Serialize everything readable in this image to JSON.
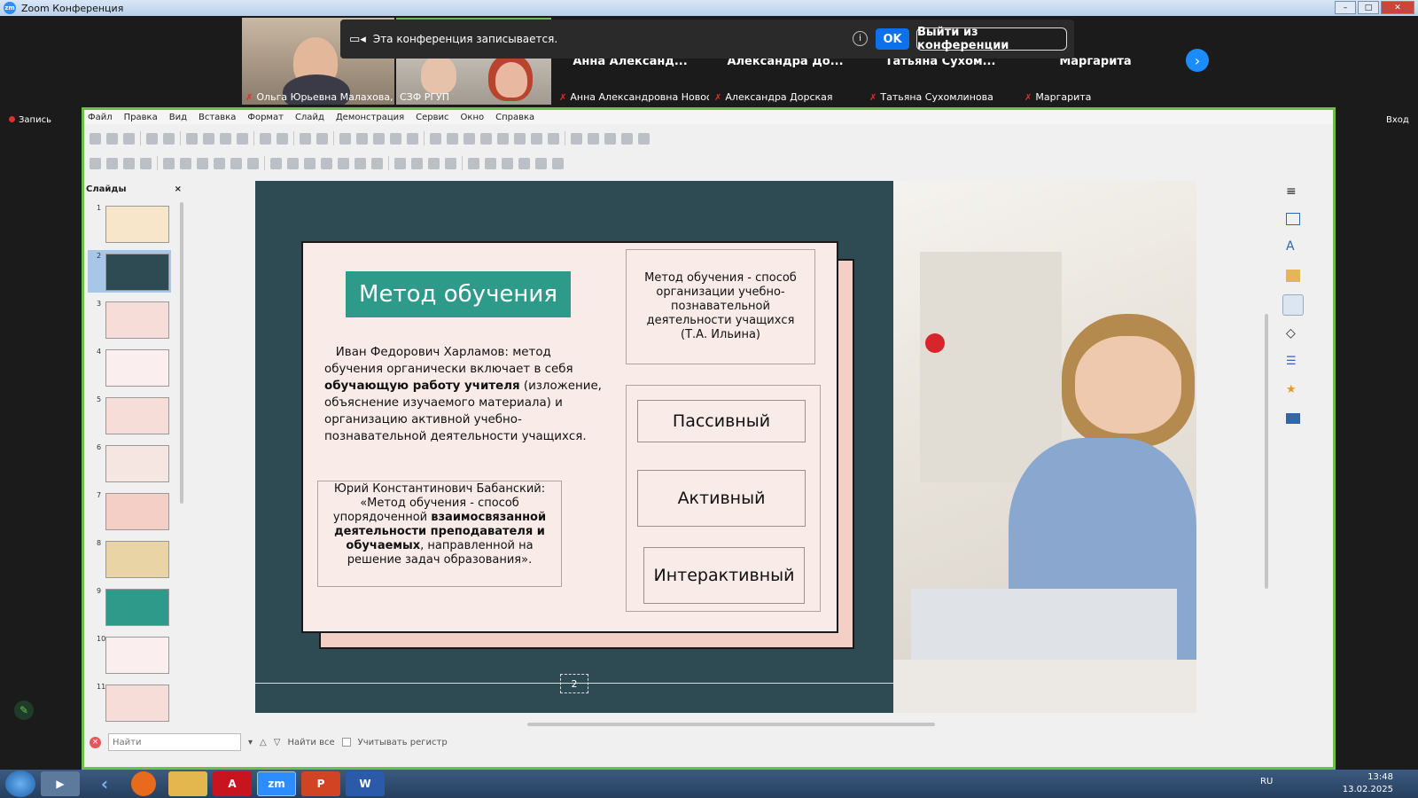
{
  "window": {
    "title": "Zoom Конференция",
    "icon": "zm"
  },
  "recording_notice": {
    "text": "Эта конференция записывается.",
    "ok": "OK",
    "leave": "Выйти из конференции"
  },
  "participants": [
    {
      "name": "Ольга Юрьевна Малахова, ..."
    },
    {
      "name": "СЗФ РГУП"
    },
    {
      "big": "Анна  Александ...",
      "name": "Анна Александровна Новосе..."
    },
    {
      "big": "Александра  До...",
      "name": "Александра Дорская"
    },
    {
      "big": "Татьяна  Сухом...",
      "name": "Татьяна Сухомлинова"
    },
    {
      "big": "Маргарита",
      "name": "Маргарита"
    }
  ],
  "left_label": "Запись",
  "right_label": "Вход",
  "menu": [
    "Файл",
    "Правка",
    "Вид",
    "Вставка",
    "Формат",
    "Слайд",
    "Демонстрация",
    "Сервис",
    "Окно",
    "Справка"
  ],
  "slides_panel": {
    "title": "Слайды",
    "close": "×",
    "numbers": [
      "1",
      "2",
      "3",
      "4",
      "5",
      "6",
      "7",
      "8",
      "9",
      "10",
      "11"
    ]
  },
  "slide": {
    "title": "Метод обучения",
    "kharlamov_name": "Иван Федорович Харламов",
    "kharlamov_pre": ": метод обучения органически включает в себя ",
    "kharlamov_bold": "обучающую работу учителя",
    "kharlamov_post": " (изложение, объяснение изучаемого материала) и организацию активной учебно-познавательной деятельности учащихся.",
    "babansky_line1": "Юрий Константинович Бабанский:",
    "babansky_pre": "«Метод обучения  - способ упорядоченной ",
    "babansky_bold": "взаимосвязанной деятельности преподавателя и обучаемых",
    "babansky_post": ", направленной на решение задач образования».",
    "definition": "Метод обучения - способ организации учебно-познавательной деятельности учащихся (Т.А. Ильина)",
    "types": [
      "Пассивный",
      "Активный",
      "Интерактивный"
    ],
    "page": "2"
  },
  "find": {
    "placeholder": "Найти",
    "find_all": "Найти все",
    "match_case": "Учитывать регистр"
  },
  "taskbar": {
    "apps": [
      "zm"
    ],
    "lang": "RU",
    "time": "13:48",
    "date": "13.02.2025"
  },
  "colors": {
    "accent": "#2e9a8a",
    "slide_bg": "#2e4a52",
    "zoom_blue": "#0e71eb",
    "share_border": "#6cc04a"
  }
}
